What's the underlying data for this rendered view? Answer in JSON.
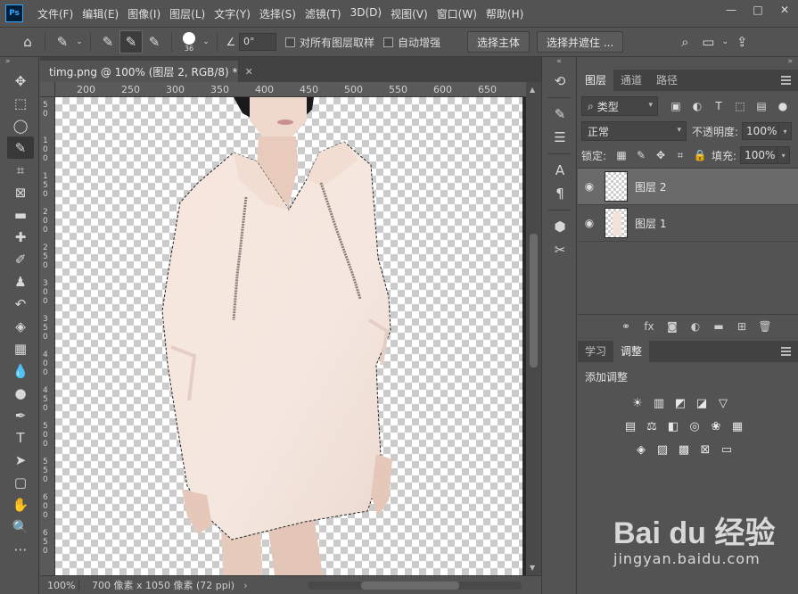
{
  "app": {
    "logo_text": "Ps",
    "menu": [
      "文件(F)",
      "编辑(E)",
      "图像(I)",
      "图层(L)",
      "文字(Y)",
      "选择(S)",
      "滤镜(T)",
      "3D(D)",
      "视图(V)",
      "窗口(W)",
      "帮助(H)"
    ]
  },
  "window_controls": {
    "minimize": "—",
    "maximize": "□",
    "close": "✕"
  },
  "options": {
    "brush_size": "36",
    "angle": "0°",
    "sample_all_layers": "对所有图层取样",
    "auto_enhance": "自动增强",
    "select_subject": "选择主体",
    "select_and_mask": "选择并遮住 ..."
  },
  "document": {
    "tab_title": "timg.png @ 100% (图层 2, RGB/8) *",
    "ruler_top": [
      "200",
      "250",
      "300",
      "350",
      "400",
      "450",
      "500",
      "550",
      "600",
      "650"
    ],
    "ruler_left": [
      "50",
      "100",
      "150",
      "200",
      "250",
      "300",
      "350",
      "400",
      "450",
      "500",
      "550",
      "600",
      "650"
    ],
    "zoom": "100%",
    "doc_info": "700 像素 x 1050 像素 (72 ppi)"
  },
  "layers_panel": {
    "tabs": [
      "图层",
      "通道",
      "路径"
    ],
    "filter_kind": "类型",
    "blend_mode": "正常",
    "opacity_label": "不透明度:",
    "opacity": "100%",
    "lock_label": "锁定:",
    "fill_label": "填充:",
    "fill": "100%",
    "layers": [
      {
        "name": "图层 2",
        "selected": true
      },
      {
        "name": "图层 1",
        "selected": false
      }
    ]
  },
  "adjustments_panel": {
    "tabs": [
      "学习",
      "调整"
    ],
    "title": "添加调整"
  },
  "watermark": {
    "logo": "Bai du 经验",
    "url": "jingyan.baidu.com"
  },
  "colors": {
    "panel_bg": "#535353",
    "dark_bg": "#424242",
    "canvas_bg": "#282828",
    "ps_blue": "#31a8ff"
  }
}
